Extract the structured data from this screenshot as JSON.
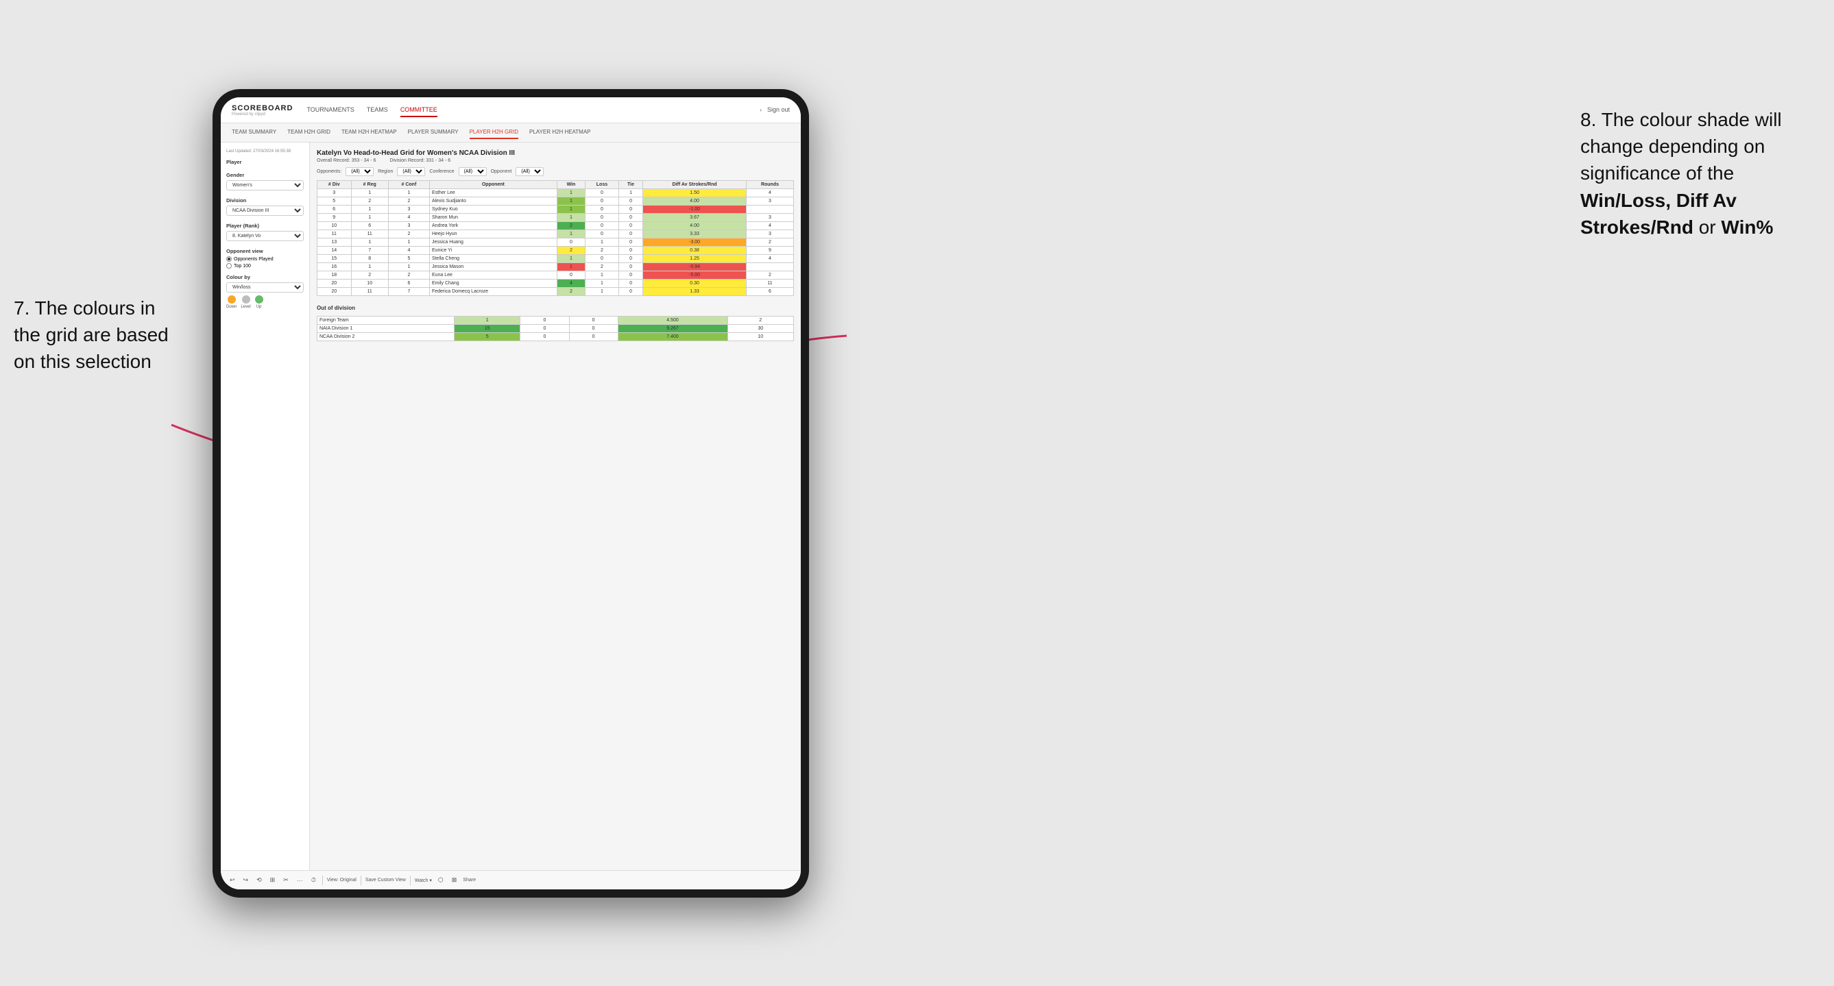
{
  "annotations": {
    "left_title": "7. The colours in the grid are based on this selection",
    "right_title": "8. The colour shade will change depending on significance of the",
    "right_bold1": "Win/Loss, Diff Av Strokes/Rnd",
    "right_or": " or ",
    "right_bold2": "Win%"
  },
  "nav": {
    "logo": "SCOREBOARD",
    "logo_sub": "Powered by clippd",
    "links": [
      "TOURNAMENTS",
      "TEAMS",
      "COMMITTEE"
    ],
    "active_link": "COMMITTEE",
    "right_items": [
      "Sign out"
    ],
    "sub_links": [
      "TEAM SUMMARY",
      "TEAM H2H GRID",
      "TEAM H2H HEATMAP",
      "PLAYER SUMMARY",
      "PLAYER H2H GRID",
      "PLAYER H2H HEATMAP"
    ],
    "active_sub": "PLAYER H2H GRID"
  },
  "sidebar": {
    "timestamp": "Last Updated: 27/03/2024 16:55:38",
    "player_label": "Player",
    "gender_label": "Gender",
    "gender_value": "Women's",
    "division_label": "Division",
    "division_value": "NCAA Division III",
    "player_rank_label": "Player (Rank)",
    "player_rank_value": "8. Katelyn Vo",
    "opponent_view_label": "Opponent view",
    "opponent_options": [
      "Opponents Played",
      "Top 100"
    ],
    "opponent_selected": "Opponents Played",
    "colour_by_label": "Colour by",
    "colour_by_value": "Win/loss",
    "legend": [
      {
        "label": "Down",
        "color": "#f9a825"
      },
      {
        "label": "Level",
        "color": "#bdbdbd"
      },
      {
        "label": "Up",
        "color": "#66bb6a"
      }
    ]
  },
  "grid": {
    "title": "Katelyn Vo Head-to-Head Grid for Women's NCAA Division III",
    "overall_record_label": "Overall Record:",
    "overall_record": "353 - 34 - 6",
    "division_record_label": "Division Record:",
    "division_record": "331 - 34 - 6",
    "opponents_label": "Opponents:",
    "opponents_value": "(All)",
    "region_label": "Region",
    "region_value": "(All)",
    "conference_label": "Conference",
    "conference_value": "(All)",
    "opponent_label": "Opponent",
    "opponent_value": "(All)",
    "columns": [
      "# Div",
      "# Reg",
      "# Conf",
      "Opponent",
      "Win",
      "Loss",
      "Tie",
      "Diff Av Strokes/Rnd",
      "Rounds"
    ],
    "rows": [
      {
        "div": 3,
        "reg": 1,
        "conf": 1,
        "opponent": "Esther Lee",
        "win": 1,
        "loss": 0,
        "tie": 1,
        "diff": 1.5,
        "rounds": 4,
        "win_color": "green-light",
        "diff_color": "yellow"
      },
      {
        "div": 5,
        "reg": 2,
        "conf": 2,
        "opponent": "Alexis Sudjianto",
        "win": 1,
        "loss": 0,
        "tie": 0,
        "diff": 4.0,
        "rounds": 3,
        "win_color": "green-med",
        "diff_color": "green-light"
      },
      {
        "div": 6,
        "reg": 1,
        "conf": 3,
        "opponent": "Sydney Kuo",
        "win": 1,
        "loss": 0,
        "tie": 0,
        "diff": -1.0,
        "rounds": "",
        "win_color": "green-med",
        "diff_color": "red"
      },
      {
        "div": 9,
        "reg": 1,
        "conf": 4,
        "opponent": "Sharon Mun",
        "win": 1,
        "loss": 0,
        "tie": 0,
        "diff": 3.67,
        "rounds": 3,
        "win_color": "green-light",
        "diff_color": "green-light"
      },
      {
        "div": 10,
        "reg": 6,
        "conf": 3,
        "opponent": "Andrea York",
        "win": 2,
        "loss": 0,
        "tie": 0,
        "diff": 4.0,
        "rounds": 4,
        "win_color": "green-dark",
        "diff_color": "green-light"
      },
      {
        "div": 11,
        "reg": 11,
        "conf": 2,
        "opponent": "Heejo Hyun",
        "win": 1,
        "loss": 0,
        "tie": 0,
        "diff": 3.33,
        "rounds": 3,
        "win_color": "green-light",
        "diff_color": "green-light"
      },
      {
        "div": 13,
        "reg": 1,
        "conf": 1,
        "opponent": "Jessica Huang",
        "win": 0,
        "loss": 1,
        "tie": 0,
        "diff": -3.0,
        "rounds": 2,
        "win_color": "white",
        "diff_color": "orange"
      },
      {
        "div": 14,
        "reg": 7,
        "conf": 4,
        "opponent": "Eunice Yi",
        "win": 2,
        "loss": 2,
        "tie": 0,
        "diff": 0.38,
        "rounds": 9,
        "win_color": "yellow",
        "diff_color": "yellow"
      },
      {
        "div": 15,
        "reg": 8,
        "conf": 5,
        "opponent": "Stella Cheng",
        "win": 1,
        "loss": 0,
        "tie": 0,
        "diff": 1.25,
        "rounds": 4,
        "win_color": "green-light",
        "diff_color": "yellow"
      },
      {
        "div": 16,
        "reg": 1,
        "conf": 1,
        "opponent": "Jessica Mason",
        "win": 1,
        "loss": 2,
        "tie": 0,
        "diff": -0.94,
        "rounds": "",
        "win_color": "red",
        "diff_color": "red"
      },
      {
        "div": 18,
        "reg": 2,
        "conf": 2,
        "opponent": "Euna Lee",
        "win": 0,
        "loss": 1,
        "tie": 0,
        "diff": -5.0,
        "rounds": 2,
        "win_color": "white",
        "diff_color": "red"
      },
      {
        "div": 20,
        "reg": 10,
        "conf": 6,
        "opponent": "Emily Chang",
        "win": 4,
        "loss": 1,
        "tie": 0,
        "diff": 0.3,
        "rounds": 11,
        "win_color": "green-dark",
        "diff_color": "yellow"
      },
      {
        "div": 20,
        "reg": 11,
        "conf": 7,
        "opponent": "Federica Domecq Lacroze",
        "win": 2,
        "loss": 1,
        "tie": 0,
        "diff": 1.33,
        "rounds": 6,
        "win_color": "green-light",
        "diff_color": "yellow"
      }
    ],
    "out_of_division_label": "Out of division",
    "out_rows": [
      {
        "opponent": "Foreign Team",
        "win": 1,
        "loss": 0,
        "tie": 0,
        "diff": 4.5,
        "rounds": 2,
        "win_color": "green-light",
        "diff_color": "green-light"
      },
      {
        "opponent": "NAIA Division 1",
        "win": 15,
        "loss": 0,
        "tie": 0,
        "diff": 9.267,
        "rounds": 30,
        "win_color": "green-dark",
        "diff_color": "green-dark"
      },
      {
        "opponent": "NCAA Division 2",
        "win": 5,
        "loss": 0,
        "tie": 0,
        "diff": 7.4,
        "rounds": 10,
        "win_color": "green-med",
        "diff_color": "green-med"
      }
    ]
  },
  "toolbar": {
    "buttons": [
      "↩",
      "↪",
      "⟲",
      "⊞",
      "✂",
      "·",
      "⏱"
    ],
    "view_label": "View: Original",
    "save_label": "Save Custom View",
    "watch_label": "Watch ▾",
    "share_label": "Share"
  }
}
